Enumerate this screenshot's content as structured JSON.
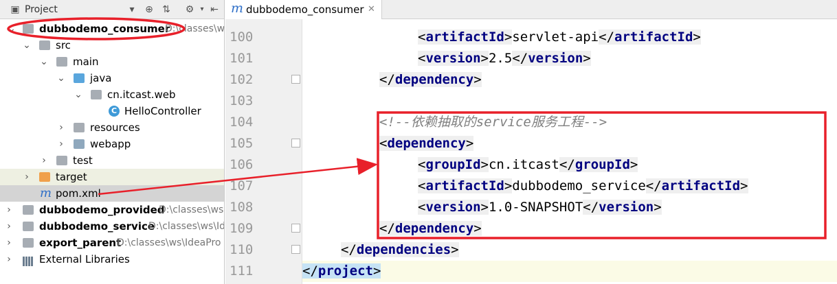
{
  "project": {
    "toolbar_label": "Project",
    "items": [
      {
        "label": "dubbodemo_consumer",
        "path": "D:\\classes\\ws"
      },
      {
        "label": "src"
      },
      {
        "label": "main"
      },
      {
        "label": "java"
      },
      {
        "label": "cn.itcast.web"
      },
      {
        "label": "HelloController"
      },
      {
        "label": "resources"
      },
      {
        "label": "webapp"
      },
      {
        "label": "test"
      },
      {
        "label": "target"
      },
      {
        "label": "pom.xml"
      },
      {
        "label": "dubbodemo_provided",
        "path": "D:\\classes\\ws"
      },
      {
        "label": "dubbodemo_service",
        "path": "D:\\classes\\ws\\Id"
      },
      {
        "label": "export_parent",
        "path": "D:\\classes\\ws\\IdeaPro"
      },
      {
        "label": "External Libraries"
      }
    ]
  },
  "editor": {
    "tab": {
      "label": "dubbodemo_consumer"
    },
    "lines": [
      {
        "num": "100"
      },
      {
        "num": "101"
      },
      {
        "num": "102"
      },
      {
        "num": "103"
      },
      {
        "num": "104"
      },
      {
        "num": "105"
      },
      {
        "num": "106"
      },
      {
        "num": "107"
      },
      {
        "num": "108"
      },
      {
        "num": "109"
      },
      {
        "num": "110"
      },
      {
        "num": "111"
      }
    ],
    "code": {
      "l100_tag": "artifactId",
      "l100_text": "servlet-api",
      "l101_tag": "version",
      "l101_text": "2.5",
      "l102_tag": "dependency",
      "l104_comment": "<!--依赖抽取的service服务工程-->",
      "l105_tag": "dependency",
      "l106_tag": "groupId",
      "l106_text": "cn.itcast",
      "l107_tag": "artifactId",
      "l107_text": "dubbodemo_service",
      "l108_tag": "version",
      "l108_text": "1.0-SNAPSHOT",
      "l109_tag": "dependency",
      "l110_tag": "dependencies",
      "l111_tag": "project"
    }
  },
  "colors": {
    "annotation": "#e8202a",
    "tag": "#000080",
    "comment": "#808080",
    "selection": "#d4d4d4"
  },
  "icons": [
    "project-view-icon",
    "dropdown-icon",
    "locate-icon",
    "collapse-all-icon",
    "settings-icon",
    "hide-panel-icon",
    "maven-icon",
    "folder-icon",
    "class-icon",
    "library-icon",
    "close-icon",
    "fold-icon"
  ]
}
